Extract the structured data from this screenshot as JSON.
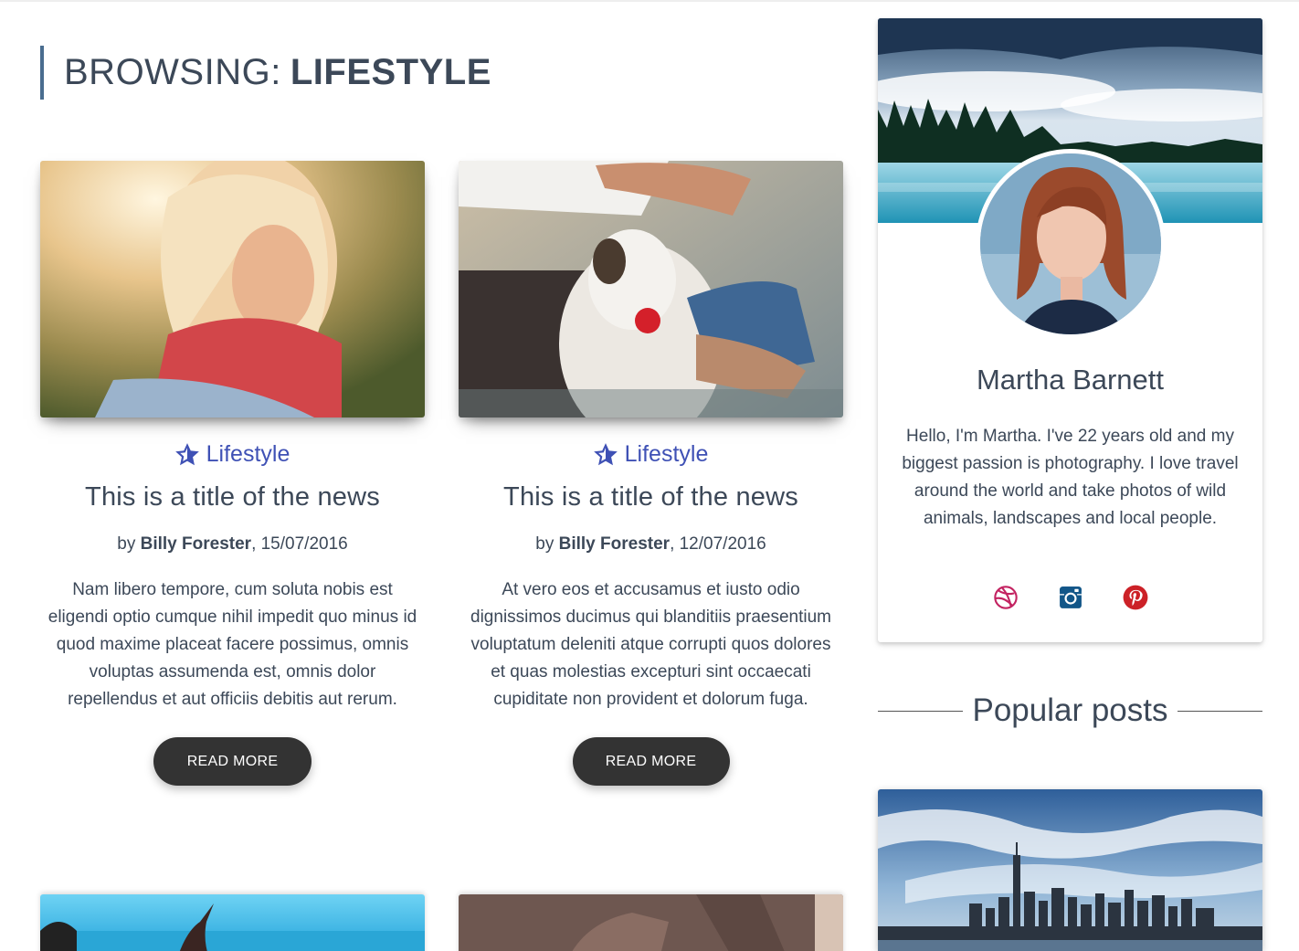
{
  "header": {
    "prefix": "BROWSING:",
    "category": "LIFESTYLE"
  },
  "posts": [
    {
      "category": "Lifestyle",
      "title": "This is a title of the news",
      "by": "by",
      "author": "Billy Forester",
      "date": ", 15/07/2016",
      "excerpt": "Nam libero tempore, cum soluta nobis est eligendi optio cumque nihil impedit quo minus id quod maxime placeat facere possimus, omnis voluptas assumenda est, omnis dolor repellendus et aut officiis debitis aut rerum.",
      "button": "READ MORE"
    },
    {
      "category": "Lifestyle",
      "title": "This is a title of the news",
      "by": "by",
      "author": "Billy Forester",
      "date": ", 12/07/2016",
      "excerpt": "At vero eos et accusamus et iusto odio dignissimos ducimus qui blanditiis praesentium voluptatum deleniti atque corrupti quos dolores et quas molestias excepturi sint occaecati cupiditate non provident et dolorum fuga.",
      "button": "READ MORE"
    }
  ],
  "profile": {
    "name": "Martha Barnett",
    "bio": "Hello, I'm Martha. I've 22 years old and my biggest passion is photography. I love travel around the world and take photos of wild animals, landscapes and local people.",
    "social": [
      {
        "icon": "dribbble-icon",
        "color": "#c32361"
      },
      {
        "icon": "instagram-icon",
        "color": "#125688"
      },
      {
        "icon": "pinterest-icon",
        "color": "#cc2127"
      }
    ]
  },
  "sidebar": {
    "popular_title": "Popular posts"
  },
  "colors": {
    "accent": "#3f51b5",
    "button": "#333333",
    "text": "#3c4858",
    "header_bar": "#4a6d8f"
  }
}
